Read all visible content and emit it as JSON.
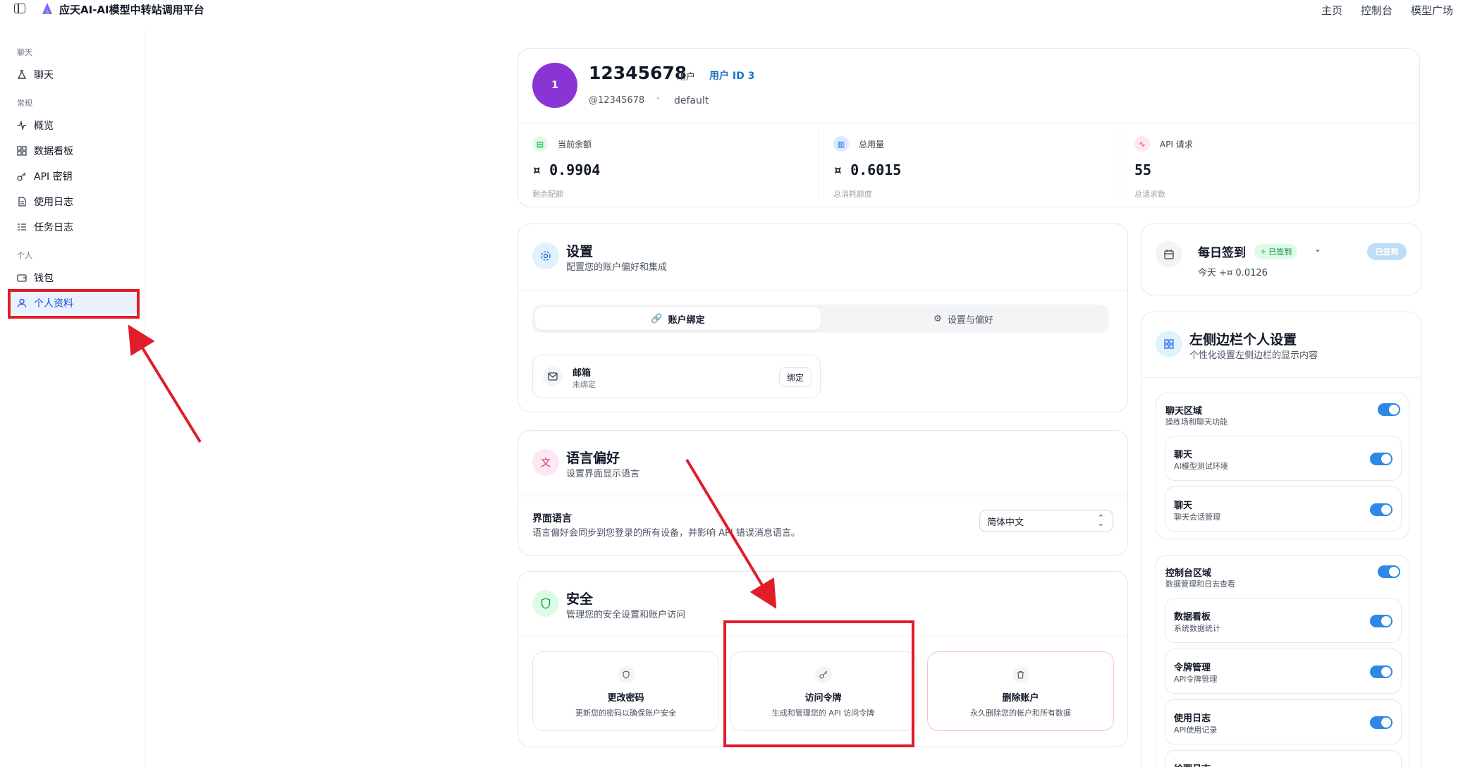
{
  "app": {
    "title": "应天AI-AI模型中转站调用平台"
  },
  "topnav": [
    "主页",
    "控制台",
    "模型广场"
  ],
  "sidebar": {
    "sections": [
      {
        "label": "聊天",
        "items": [
          {
            "label": "聊天",
            "icon": "flask-icon"
          }
        ]
      },
      {
        "label": "常规",
        "items": [
          {
            "label": "概览",
            "icon": "activity-icon"
          },
          {
            "label": "数据看板",
            "icon": "dashboard-icon"
          },
          {
            "label": "API 密钥",
            "icon": "key-icon"
          },
          {
            "label": "使用日志",
            "icon": "file-text-icon"
          },
          {
            "label": "任务日志",
            "icon": "list-check-icon"
          }
        ]
      },
      {
        "label": "个人",
        "items": [
          {
            "label": "钱包",
            "icon": "wallet-icon"
          },
          {
            "label": "个人资料",
            "icon": "user-icon"
          }
        ]
      }
    ]
  },
  "profile": {
    "avatar_text": "1",
    "username": "12345678",
    "role": "用户",
    "user_id": "用户 ID 3",
    "handle": "@12345678",
    "separator": "·",
    "group": "default",
    "stats": [
      {
        "label": "当前余额",
        "value": "¤ 0.9904",
        "desc": "剩余配额"
      },
      {
        "label": "总用量",
        "value": "¤ 0.6015",
        "desc": "总消耗额度"
      },
      {
        "label": "API 请求",
        "value": "55",
        "desc": "总请求数"
      }
    ]
  },
  "settings": {
    "title": "设置",
    "subtitle": "配置您的账户偏好和集成",
    "tabs": [
      "账户绑定",
      "设置与偏好"
    ],
    "email": {
      "title": "邮箱",
      "status": "未绑定",
      "button": "绑定"
    }
  },
  "language": {
    "title": "语言偏好",
    "subtitle": "设置界面显示语言",
    "label": "界面语言",
    "note": "语言偏好会同步到您登录的所有设备，并影响 API 错误消息语言。",
    "selected": "简体中文"
  },
  "security": {
    "title": "安全",
    "subtitle": "管理您的安全设置和账户访问",
    "tiles": [
      {
        "title": "更改密码",
        "sub": "更新您的密码以确保账户安全"
      },
      {
        "title": "访问令牌",
        "sub": "生成和管理您的 API 访问令牌"
      },
      {
        "title": "删除账户",
        "sub": "永久删除您的帐户和所有数据"
      }
    ]
  },
  "checkin": {
    "title": "每日签到",
    "badge": "已签到",
    "today": "今天 +¤ 0.0126",
    "button": "已签到"
  },
  "sidebar_settings": {
    "title": "左侧边栏个人设置",
    "subtitle": "个性化设置左侧边栏的显示内容",
    "groups": [
      {
        "title": "聊天区域",
        "sub": "操练场和聊天功能",
        "enabled": true,
        "items": [
          {
            "title": "聊天",
            "sub": "AI模型测试环境",
            "enabled": true
          },
          {
            "title": "聊天",
            "sub": "聊天会话管理",
            "enabled": true
          }
        ]
      },
      {
        "title": "控制台区域",
        "sub": "数据管理和日志查看",
        "enabled": true,
        "items": [
          {
            "title": "数据看板",
            "sub": "系统数据统计",
            "enabled": true
          },
          {
            "title": "令牌管理",
            "sub": "API令牌管理",
            "enabled": true
          },
          {
            "title": "使用日志",
            "sub": "API使用记录",
            "enabled": true
          },
          {
            "title": "绘图日志",
            "sub": "",
            "enabled": true
          }
        ]
      }
    ]
  },
  "colors": {
    "accent": "#2f88e6",
    "avatar": "#8b34d6",
    "annotation": "#e11d2a"
  }
}
